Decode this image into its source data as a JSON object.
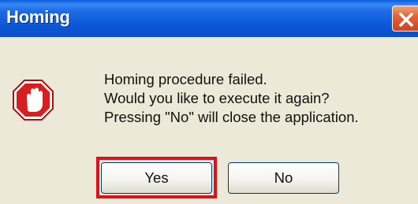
{
  "dialog": {
    "title": "Homing",
    "message_lines": [
      "Homing procedure failed.",
      "Would you like to execute it again?",
      "Pressing \"No\" will close the application."
    ],
    "buttons": {
      "yes_label": "Yes",
      "no_label": "No"
    },
    "icon": "stop-hand-icon"
  },
  "colors": {
    "titlebar": "#0c57d6",
    "close": "#e2643c",
    "dialog_bg": "#ece9d8",
    "highlight": "#e0101a",
    "stop_icon": "#d81e1e"
  }
}
